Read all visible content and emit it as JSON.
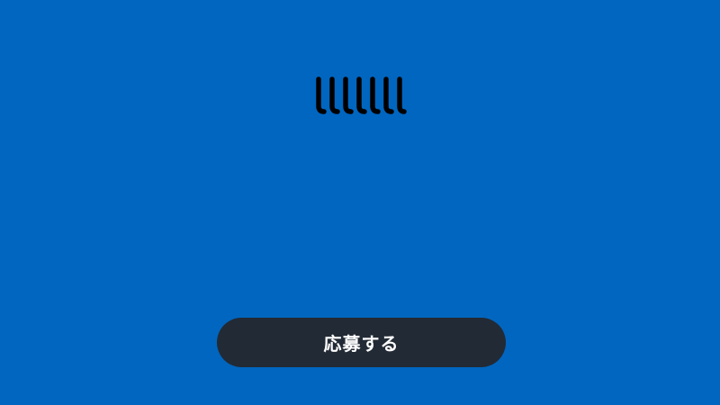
{
  "screen": {
    "background_color": "#0066c0"
  },
  "logo": {
    "icon": "striped-logo-icon",
    "color": "#000000"
  },
  "apply_button": {
    "label": "応募する",
    "background_color": "#222a35",
    "text_color": "#ffffff"
  }
}
